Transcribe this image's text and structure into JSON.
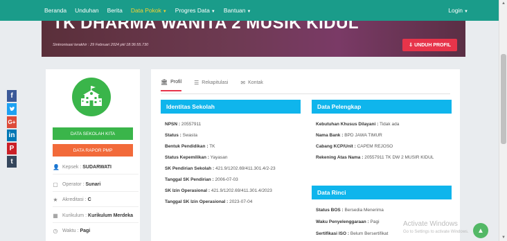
{
  "nav": {
    "items": [
      {
        "label": "Beranda"
      },
      {
        "label": "Unduhan"
      },
      {
        "label": "Berita"
      },
      {
        "label": "Data Pokok",
        "active": true
      },
      {
        "label": "Progres Data"
      },
      {
        "label": "Bantuan"
      }
    ],
    "login": "Login"
  },
  "hero": {
    "title": "TK DHARMA WANITA 2 MUSIK KIDUL",
    "sync": "Sinkronisasi terakhir : 29 Februari 2024 pkl 18:36:55.730",
    "unduh_label": "UNDUH PROFIL"
  },
  "share": [
    {
      "icon": "facebook-icon",
      "glyph": "f",
      "color": "#3b5998"
    },
    {
      "icon": "twitter-icon",
      "glyph": "🐦",
      "color": "#1da1f2"
    },
    {
      "icon": "googleplus-icon",
      "glyph": "G+",
      "color": "#dd4b39"
    },
    {
      "icon": "linkedin-icon",
      "glyph": "in",
      "color": "#0077b5"
    },
    {
      "icon": "pinterest-icon",
      "glyph": "P",
      "color": "#cb2027"
    },
    {
      "icon": "tumblr-icon",
      "glyph": "t",
      "color": "#35465c"
    }
  ],
  "left": {
    "btn_data_sekolah": "DATA SEKOLAH KITA",
    "btn_rapor": "DATA RAPOR PMP",
    "items": [
      {
        "label": "Kepsek :",
        "value": "SUDARWATI",
        "icon": "user-icon"
      },
      {
        "label": "Operator :",
        "value": "Sunari",
        "icon": "operator-icon"
      },
      {
        "label": "Akreditasi :",
        "value": "C",
        "icon": "star-icon"
      },
      {
        "label": "Kurikulum :",
        "value": "Kurikulum Merdeka",
        "icon": "curriculum-icon"
      },
      {
        "label": "Waktu :",
        "value": "Pagi",
        "icon": "clock-icon"
      }
    ]
  },
  "tabs": [
    {
      "label": "Profil",
      "icon": "school-icon",
      "active": true
    },
    {
      "label": "Rekapitulasi",
      "icon": "list-icon"
    },
    {
      "label": "Kontak",
      "icon": "mail-icon"
    }
  ],
  "identitas": {
    "title": "Identitas Sekolah",
    "rows": [
      {
        "k": "NPSN :",
        "v": "20557911"
      },
      {
        "k": "Status :",
        "v": "Swasta"
      },
      {
        "k": "Bentuk Pendidikan :",
        "v": "TK"
      },
      {
        "k": "Status Kepemilikan :",
        "v": "Yayasan"
      },
      {
        "k": "SK Pendirian Sekolah :",
        "v": "421.9/1202.69/411.301.4/2-23"
      },
      {
        "k": "Tanggal SK Pendirian :",
        "v": "2006-07-03"
      },
      {
        "k": "SK Izin Operasional :",
        "v": "421.9/1202.69/411.301.4/2023"
      },
      {
        "k": "Tanggal SK Izin Operasional :",
        "v": "2023-07-04"
      }
    ]
  },
  "pelengkap": {
    "title": "Data Pelengkap",
    "rows": [
      {
        "k": "Kebutuhan Khusus Dilayani :",
        "v": "Tidak ada"
      },
      {
        "k": "Nama Bank :",
        "v": "BPD JAWA TIMUR"
      },
      {
        "k": "Cabang KCP/Unit :",
        "v": "CAPEM REJOSO"
      },
      {
        "k": "Rekening Atas Nama :",
        "v": "20557911 TK DW 2 MUSIR KIDUL"
      }
    ]
  },
  "rinci": {
    "title": "Data Rinci",
    "rows": [
      {
        "k": "Status BOS :",
        "v": "Bersedia Menerima"
      },
      {
        "k": "Waku Penyelenggaraan :",
        "v": "Pagi"
      },
      {
        "k": "Sertifikasi ISO :",
        "v": "Belum Bersertifikat"
      }
    ]
  },
  "watermark": {
    "line1": "Activate Windows",
    "line2": "Go to Settings to activate Windows."
  }
}
